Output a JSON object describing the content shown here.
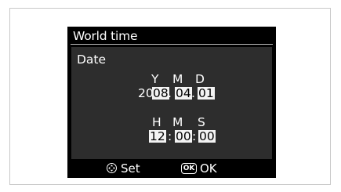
{
  "screen": {
    "title": "World time",
    "section_label": "Date",
    "date": {
      "headers": {
        "year": "Y",
        "month": "M",
        "day": "D"
      },
      "year_prefix": "20",
      "year_value": "08",
      "month_value": "04",
      "day_value": "01",
      "separator": "."
    },
    "time": {
      "headers": {
        "hour": "H",
        "minute": "M",
        "second": "S"
      },
      "hour_value": "12",
      "minute_value": "00",
      "second_value": "00",
      "separator": ":"
    },
    "footer": {
      "set_icon": "multi-selector-icon",
      "set_label": "Set",
      "ok_icon": "ok-button-icon",
      "ok_icon_text": "OK",
      "ok_label": "OK"
    }
  },
  "colors": {
    "screen_bg": "#000000",
    "panel_bg": "#2d2d2d",
    "text": "#ffffff",
    "selected_bg": "#f3f3f3",
    "frame_border": "#c8c8c8"
  }
}
